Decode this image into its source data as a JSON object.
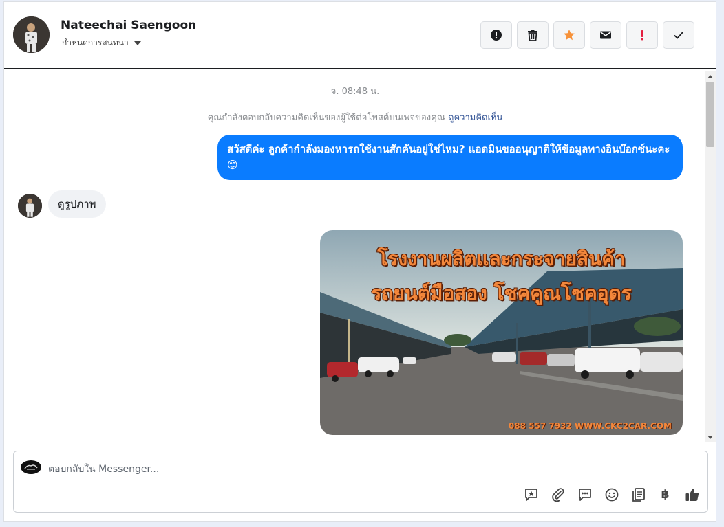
{
  "header": {
    "contact_name": "Nateechai Saengoon",
    "assign_label": "กำหนดการสนทนา",
    "actions": [
      {
        "name": "spam-button",
        "icon": "alert-circle-icon"
      },
      {
        "name": "delete-button",
        "icon": "trash-icon"
      },
      {
        "name": "star-button",
        "icon": "star-icon"
      },
      {
        "name": "mark-unread-button",
        "icon": "envelope-icon"
      },
      {
        "name": "follow-up-button",
        "icon": "exclamation-icon"
      },
      {
        "name": "mark-done-button",
        "icon": "checkmark-icon"
      }
    ]
  },
  "conversation": {
    "timestamp": "จ. 08:48 น.",
    "reply_note": "คุณกำลังตอบกลับความคิดเห็นของผู้ใช้ต่อโพสต์บนเพจของคุณ",
    "reply_note_link": "ดูความคิดเห็น",
    "outgoing_message": "สวัสดีค่ะ ลูกค้ากำลังมองหารถใช้งานสักคันอยู่ใช่ไหม? แอดมินขออนุญาติให้ข้อมูลทางอินบ๊อกซ์นะคะ 😊",
    "incoming_message": "ดูรูปภาพ",
    "photo": {
      "title_line1": "โรงงานผลิตและกระจายสินค้า",
      "title_line2": "รถยนต์มือสอง โชคคูณโชคอุดร",
      "footer": "088 557 7932 WWW.CKC2CAR.COM"
    }
  },
  "composer": {
    "placeholder": "ตอบกลับใน Messenger...",
    "currency_symbol": "฿"
  },
  "colors": {
    "outgoing_bubble": "#0a7cff",
    "star": "#f7923a",
    "follow_up": "#e41e3f"
  }
}
